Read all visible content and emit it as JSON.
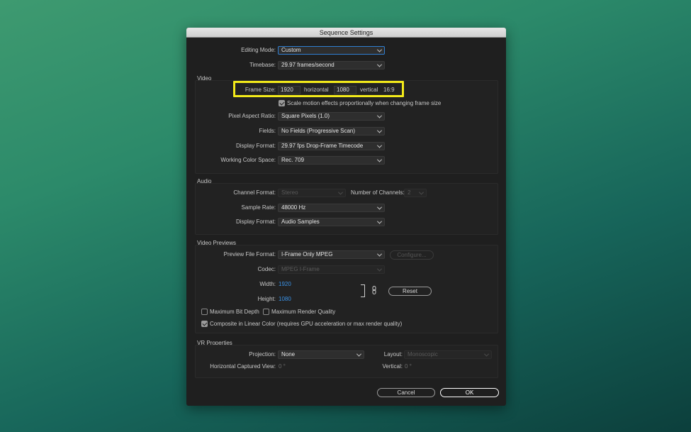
{
  "dialog": {
    "title": "Sequence Settings",
    "editing_mode": {
      "label": "Editing Mode:",
      "value": "Custom"
    },
    "timebase": {
      "label": "Timebase:",
      "value": "29.97  frames/second"
    }
  },
  "video": {
    "section": "Video",
    "frame_size_label": "Frame Size:",
    "horizontal_value": "1920",
    "horizontal_label": "horizontal",
    "vertical_value": "1080",
    "vertical_label": "vertical",
    "aspect": "16:9",
    "scale_checkbox": {
      "label": "Scale motion effects proportionally when changing frame size",
      "checked": true
    },
    "pixel_aspect": {
      "label": "Pixel Aspect Ratio:",
      "value": "Square Pixels (1.0)"
    },
    "fields": {
      "label": "Fields:",
      "value": "No Fields (Progressive Scan)"
    },
    "display_format": {
      "label": "Display Format:",
      "value": "29.97 fps Drop-Frame Timecode"
    },
    "working_color_space": {
      "label": "Working Color Space:",
      "value": "Rec. 709"
    }
  },
  "audio": {
    "section": "Audio",
    "channel_format": {
      "label": "Channel Format:",
      "value": "Stereo"
    },
    "num_channels": {
      "label": "Number of Channels:",
      "value": "2"
    },
    "sample_rate": {
      "label": "Sample Rate:",
      "value": "48000 Hz"
    },
    "display_format": {
      "label": "Display Format:",
      "value": "Audio Samples"
    }
  },
  "previews": {
    "section": "Video Previews",
    "file_format": {
      "label": "Preview File Format:",
      "value": "I-Frame Only MPEG"
    },
    "configure_label": "Configure...",
    "codec": {
      "label": "Codec:",
      "value": "MPEG I-Frame"
    },
    "width": {
      "label": "Width:",
      "value": "1920"
    },
    "height": {
      "label": "Height:",
      "value": "1080"
    },
    "reset_label": "Reset",
    "max_bit_depth": {
      "label": "Maximum Bit Depth",
      "checked": false
    },
    "max_render_quality": {
      "label": "Maximum Render Quality",
      "checked": false
    },
    "composite_linear": {
      "label": "Composite in Linear Color (requires GPU acceleration or max render quality)",
      "checked": true
    }
  },
  "vr": {
    "section": "VR Properties",
    "projection": {
      "label": "Projection:",
      "value": "None"
    },
    "layout": {
      "label": "Layout:",
      "value": "Monoscopic"
    },
    "h_captured": {
      "label": "Horizontal Captured View:",
      "value": "0 °"
    },
    "vertical": {
      "label": "Vertical:",
      "value": "0 °"
    }
  },
  "footer": {
    "cancel_label": "Cancel",
    "ok_label": "OK"
  },
  "colors": {
    "highlight": "#f3ea1a",
    "accent_blue": "#3a92e6",
    "focus_ring": "#2f7fd3"
  }
}
